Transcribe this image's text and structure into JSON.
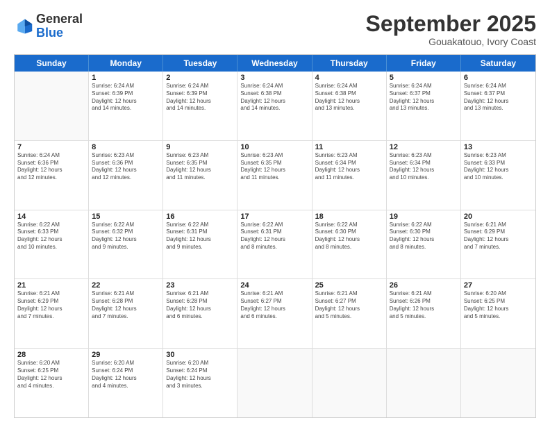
{
  "logo": {
    "line1": "General",
    "line2": "Blue"
  },
  "title": "September 2025",
  "location": "Gouakatouo, Ivory Coast",
  "header_days": [
    "Sunday",
    "Monday",
    "Tuesday",
    "Wednesday",
    "Thursday",
    "Friday",
    "Saturday"
  ],
  "weeks": [
    [
      {
        "day": "",
        "info": ""
      },
      {
        "day": "1",
        "info": "Sunrise: 6:24 AM\nSunset: 6:39 PM\nDaylight: 12 hours\nand 14 minutes."
      },
      {
        "day": "2",
        "info": "Sunrise: 6:24 AM\nSunset: 6:39 PM\nDaylight: 12 hours\nand 14 minutes."
      },
      {
        "day": "3",
        "info": "Sunrise: 6:24 AM\nSunset: 6:38 PM\nDaylight: 12 hours\nand 14 minutes."
      },
      {
        "day": "4",
        "info": "Sunrise: 6:24 AM\nSunset: 6:38 PM\nDaylight: 12 hours\nand 13 minutes."
      },
      {
        "day": "5",
        "info": "Sunrise: 6:24 AM\nSunset: 6:37 PM\nDaylight: 12 hours\nand 13 minutes."
      },
      {
        "day": "6",
        "info": "Sunrise: 6:24 AM\nSunset: 6:37 PM\nDaylight: 12 hours\nand 13 minutes."
      }
    ],
    [
      {
        "day": "7",
        "info": "Sunrise: 6:24 AM\nSunset: 6:36 PM\nDaylight: 12 hours\nand 12 minutes."
      },
      {
        "day": "8",
        "info": "Sunrise: 6:23 AM\nSunset: 6:36 PM\nDaylight: 12 hours\nand 12 minutes."
      },
      {
        "day": "9",
        "info": "Sunrise: 6:23 AM\nSunset: 6:35 PM\nDaylight: 12 hours\nand 11 minutes."
      },
      {
        "day": "10",
        "info": "Sunrise: 6:23 AM\nSunset: 6:35 PM\nDaylight: 12 hours\nand 11 minutes."
      },
      {
        "day": "11",
        "info": "Sunrise: 6:23 AM\nSunset: 6:34 PM\nDaylight: 12 hours\nand 11 minutes."
      },
      {
        "day": "12",
        "info": "Sunrise: 6:23 AM\nSunset: 6:34 PM\nDaylight: 12 hours\nand 10 minutes."
      },
      {
        "day": "13",
        "info": "Sunrise: 6:23 AM\nSunset: 6:33 PM\nDaylight: 12 hours\nand 10 minutes."
      }
    ],
    [
      {
        "day": "14",
        "info": "Sunrise: 6:22 AM\nSunset: 6:33 PM\nDaylight: 12 hours\nand 10 minutes."
      },
      {
        "day": "15",
        "info": "Sunrise: 6:22 AM\nSunset: 6:32 PM\nDaylight: 12 hours\nand 9 minutes."
      },
      {
        "day": "16",
        "info": "Sunrise: 6:22 AM\nSunset: 6:31 PM\nDaylight: 12 hours\nand 9 minutes."
      },
      {
        "day": "17",
        "info": "Sunrise: 6:22 AM\nSunset: 6:31 PM\nDaylight: 12 hours\nand 8 minutes."
      },
      {
        "day": "18",
        "info": "Sunrise: 6:22 AM\nSunset: 6:30 PM\nDaylight: 12 hours\nand 8 minutes."
      },
      {
        "day": "19",
        "info": "Sunrise: 6:22 AM\nSunset: 6:30 PM\nDaylight: 12 hours\nand 8 minutes."
      },
      {
        "day": "20",
        "info": "Sunrise: 6:21 AM\nSunset: 6:29 PM\nDaylight: 12 hours\nand 7 minutes."
      }
    ],
    [
      {
        "day": "21",
        "info": "Sunrise: 6:21 AM\nSunset: 6:29 PM\nDaylight: 12 hours\nand 7 minutes."
      },
      {
        "day": "22",
        "info": "Sunrise: 6:21 AM\nSunset: 6:28 PM\nDaylight: 12 hours\nand 7 minutes."
      },
      {
        "day": "23",
        "info": "Sunrise: 6:21 AM\nSunset: 6:28 PM\nDaylight: 12 hours\nand 6 minutes."
      },
      {
        "day": "24",
        "info": "Sunrise: 6:21 AM\nSunset: 6:27 PM\nDaylight: 12 hours\nand 6 minutes."
      },
      {
        "day": "25",
        "info": "Sunrise: 6:21 AM\nSunset: 6:27 PM\nDaylight: 12 hours\nand 5 minutes."
      },
      {
        "day": "26",
        "info": "Sunrise: 6:21 AM\nSunset: 6:26 PM\nDaylight: 12 hours\nand 5 minutes."
      },
      {
        "day": "27",
        "info": "Sunrise: 6:20 AM\nSunset: 6:25 PM\nDaylight: 12 hours\nand 5 minutes."
      }
    ],
    [
      {
        "day": "28",
        "info": "Sunrise: 6:20 AM\nSunset: 6:25 PM\nDaylight: 12 hours\nand 4 minutes."
      },
      {
        "day": "29",
        "info": "Sunrise: 6:20 AM\nSunset: 6:24 PM\nDaylight: 12 hours\nand 4 minutes."
      },
      {
        "day": "30",
        "info": "Sunrise: 6:20 AM\nSunset: 6:24 PM\nDaylight: 12 hours\nand 3 minutes."
      },
      {
        "day": "",
        "info": ""
      },
      {
        "day": "",
        "info": ""
      },
      {
        "day": "",
        "info": ""
      },
      {
        "day": "",
        "info": ""
      }
    ]
  ]
}
